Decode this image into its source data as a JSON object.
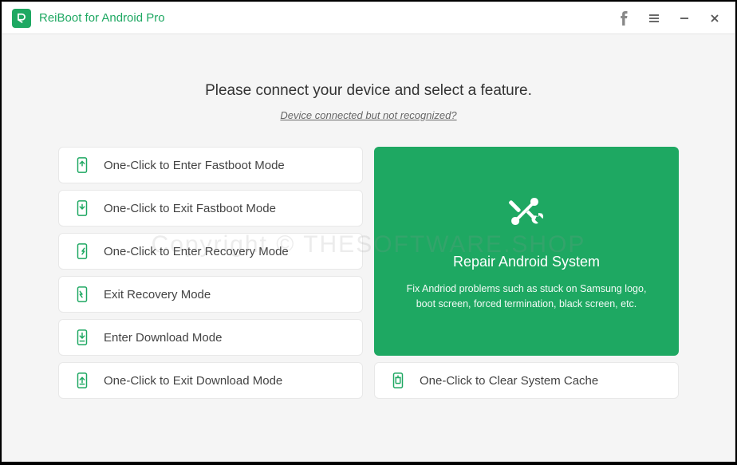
{
  "app": {
    "title": "ReiBoot for Android Pro"
  },
  "header": {
    "heading": "Please connect your device and select a feature.",
    "subheading": "Device connected but not recognized?"
  },
  "features": {
    "enter_fastboot": "One-Click to Enter Fastboot Mode",
    "exit_fastboot": "One-Click to Exit Fastboot Mode",
    "enter_recovery": "One-Click to Enter Recovery Mode",
    "exit_recovery": "Exit Recovery Mode",
    "enter_download": "Enter Download Mode",
    "exit_download": "One-Click to Exit Download Mode",
    "clear_cache": "One-Click to Clear System Cache"
  },
  "repair": {
    "title": "Repair Android System",
    "description": "Fix Andriod problems such as stuck on Samsung logo, boot screen, forced termination, black screen, etc."
  },
  "watermark": "Copyright © THESOFTWARE.SHOP"
}
